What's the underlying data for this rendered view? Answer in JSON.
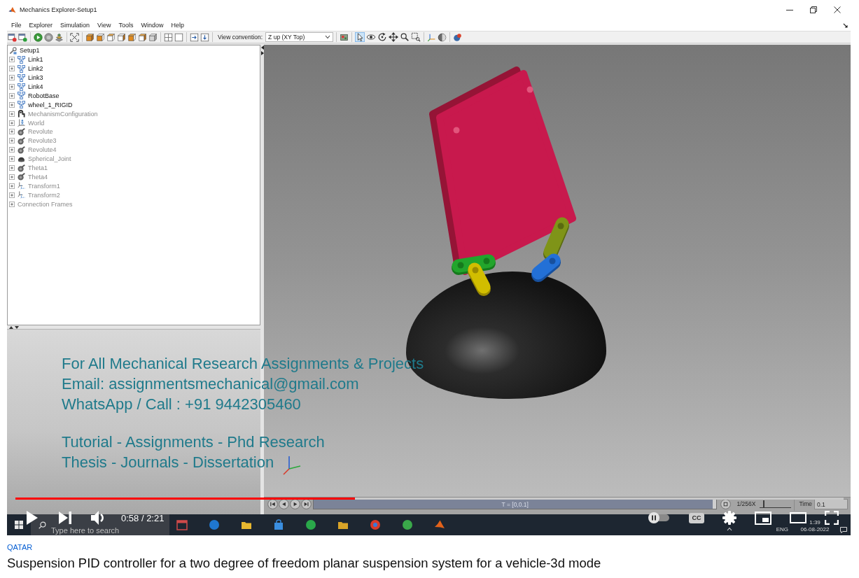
{
  "window": {
    "title": "Mechanics Explorer-Setup1"
  },
  "menu": [
    "File",
    "Explorer",
    "Simulation",
    "View",
    "Tools",
    "Window",
    "Help"
  ],
  "toolbar": {
    "view_convention": {
      "label": "View convention:",
      "value": "Z up (XY Top)"
    },
    "view_tools": [
      {
        "kind": "select",
        "selected": true
      },
      {
        "kind": "orbit",
        "selected": false
      },
      {
        "kind": "rotate",
        "selected": false
      },
      {
        "kind": "pan",
        "selected": false
      },
      {
        "kind": "zoom",
        "selected": false
      },
      {
        "kind": "zoom-box",
        "selected": false
      }
    ]
  },
  "tree": {
    "label": "Setup1",
    "children": [
      {
        "label": "Link1",
        "kind": "body",
        "dimmed": false,
        "expanded": false
      },
      {
        "label": "Link2",
        "kind": "body",
        "dimmed": false,
        "expanded": false
      },
      {
        "label": "Link3",
        "kind": "body",
        "dimmed": false,
        "expanded": false
      },
      {
        "label": "Link4",
        "kind": "body",
        "dimmed": false,
        "expanded": false
      },
      {
        "label": "RobotBase",
        "kind": "body",
        "dimmed": false,
        "expanded": false
      },
      {
        "label": "wheel_1_RIGID",
        "kind": "body",
        "dimmed": false,
        "expanded": false
      },
      {
        "label": "MechanismConfiguration",
        "kind": "config",
        "dimmed": true,
        "expanded": false
      },
      {
        "label": "World",
        "kind": "world",
        "dimmed": true,
        "expanded": false
      },
      {
        "label": "Revolute",
        "kind": "joint",
        "dimmed": true,
        "expanded": false
      },
      {
        "label": "Revolute3",
        "kind": "joint",
        "dimmed": true,
        "expanded": false
      },
      {
        "label": "Revolute4",
        "kind": "joint",
        "dimmed": true,
        "expanded": false
      },
      {
        "label": "Spherical_Joint",
        "kind": "spherical",
        "dimmed": true,
        "expanded": false
      },
      {
        "label": "Theta1",
        "kind": "joint",
        "dimmed": true,
        "expanded": false
      },
      {
        "label": "Theta4",
        "kind": "joint",
        "dimmed": true,
        "expanded": false
      },
      {
        "label": "Transform1",
        "kind": "transform",
        "dimmed": true,
        "expanded": false
      },
      {
        "label": "Transform2",
        "kind": "transform",
        "dimmed": true,
        "expanded": false
      },
      {
        "label": "Connection Frames",
        "kind": "frames",
        "dimmed": true,
        "expanded": false
      }
    ]
  },
  "playback": {
    "progress": {
      "label": "T = [0,0.1]",
      "level": 1
    },
    "speed": {
      "label": "1/256X",
      "level": 0.1
    },
    "time": {
      "label": "Time",
      "value": "0.1"
    }
  },
  "overlay_text": [
    {
      "lines": [
        "For All Mechanical Research Assignments & Projects",
        "Email: assignmentsmechanical@gmail.com",
        "WhatsApp / Call : +91 9442305460"
      ]
    },
    {
      "lines": [
        "Tutorial - Assignments - Phd Research",
        "Thesis - Journals - Dissertation"
      ]
    }
  ],
  "player": {
    "progress": {
      "level": 0.41
    },
    "time": "0:58 / 2:21",
    "autoplay": {
      "on": false
    },
    "captions": {
      "label": "CC"
    }
  },
  "taskbar": {
    "search_placeholder": "Type here to search",
    "language": "ENG",
    "clock": "1:39",
    "date": "06-08-2022"
  },
  "video_info": {
    "channel_tag": "QATAR",
    "title": "Suspension PID controller for a two degree of freedom planar suspension system for a vehicle-3d mode"
  }
}
